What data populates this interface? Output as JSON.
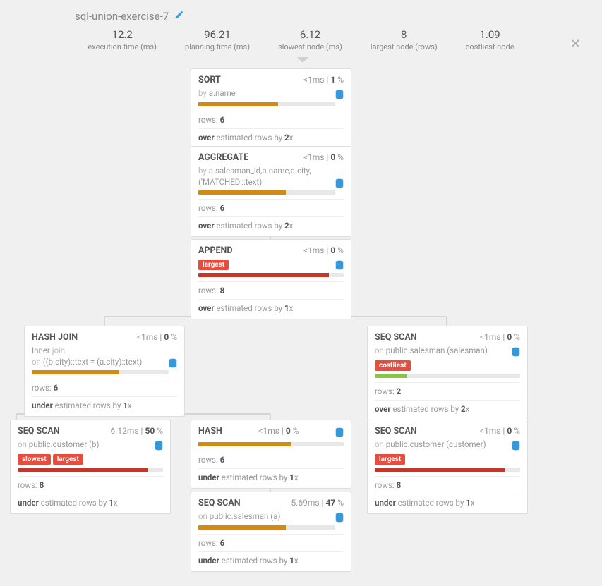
{
  "title": "sql-union-exercise-7",
  "stats": {
    "exec_val": "12.2",
    "exec_lbl": "execution time (ms)",
    "plan_val": "96.21",
    "plan_lbl": "planning time (ms)",
    "slow_val": "6.12",
    "slow_lbl": "slowest node (ms)",
    "large_val": "8",
    "large_lbl": "largest node (rows)",
    "cost_val": "1.09",
    "cost_lbl": "costliest node"
  },
  "nodes": {
    "sort": {
      "name": "SORT",
      "time": "<1",
      "pct": "1",
      "sub_prefix": "by",
      "sub": "a.name",
      "bar_w": "58%",
      "bar_cls": "orange",
      "rows": "6",
      "est_dir": "over",
      "est_x": "2"
    },
    "agg": {
      "name": "AGGREGATE",
      "time": "<1",
      "pct": "0",
      "sub_prefix": "by",
      "sub": "a.salesman_id,a.name,a.city,('MATCHED'::text)",
      "bar_w": "64%",
      "bar_cls": "orange",
      "rows": "6",
      "est_dir": "over",
      "est_x": "2"
    },
    "append": {
      "name": "APPEND",
      "time": "<1",
      "pct": "0",
      "badge1": "largest",
      "bar_w": "90%",
      "bar_cls": "red",
      "rows": "8",
      "est_dir": "over",
      "est_x": "1"
    },
    "hashjoin": {
      "name": "HASH JOIN",
      "time": "<1",
      "pct": "0",
      "sub_l1a": "Inner",
      "sub_l1b": "join",
      "sub_l2a": "on",
      "sub_l2b": "((b.city)::text = (a.city)::text)",
      "bar_w": "64%",
      "bar_cls": "orange",
      "rows": "6",
      "est_dir": "under",
      "est_x": "1"
    },
    "seqcust_b": {
      "name": "SEQ SCAN",
      "time": "6.12",
      "pct": "50",
      "sub_prefix": "on",
      "sub": "public.customer (b)",
      "badge1": "slowest",
      "badge2": "largest",
      "bar_w": "90%",
      "bar_cls": "red",
      "rows": "8",
      "est_dir": "under",
      "est_x": "1"
    },
    "hash": {
      "name": "HASH",
      "time": "<1",
      "pct": "0",
      "bar_w": "64%",
      "bar_cls": "orange",
      "rows": "6",
      "est_dir": "under",
      "est_x": "1"
    },
    "seqsales_a": {
      "name": "SEQ SCAN",
      "time": "5.69",
      "pct": "47",
      "sub_prefix": "on",
      "sub": "public.salesman (a)",
      "bar_w": "64%",
      "bar_cls": "orange",
      "rows": "6",
      "est_dir": "under",
      "est_x": "1"
    },
    "seqsales": {
      "name": "SEQ SCAN",
      "time": "<1",
      "pct": "0",
      "sub_prefix": "on",
      "sub": "public.salesman (salesman)",
      "badge1": "costliest",
      "bar_w": "22%",
      "bar_cls": "green",
      "rows": "2",
      "est_dir": "over",
      "est_x": "2"
    },
    "seqcust": {
      "name": "SEQ SCAN",
      "time": "<1",
      "pct": "0",
      "sub_prefix": "on",
      "sub": "public.customer (customer)",
      "badge1": "largest",
      "bar_w": "90%",
      "bar_cls": "red",
      "rows": "8",
      "est_dir": "under",
      "est_x": "1"
    }
  }
}
